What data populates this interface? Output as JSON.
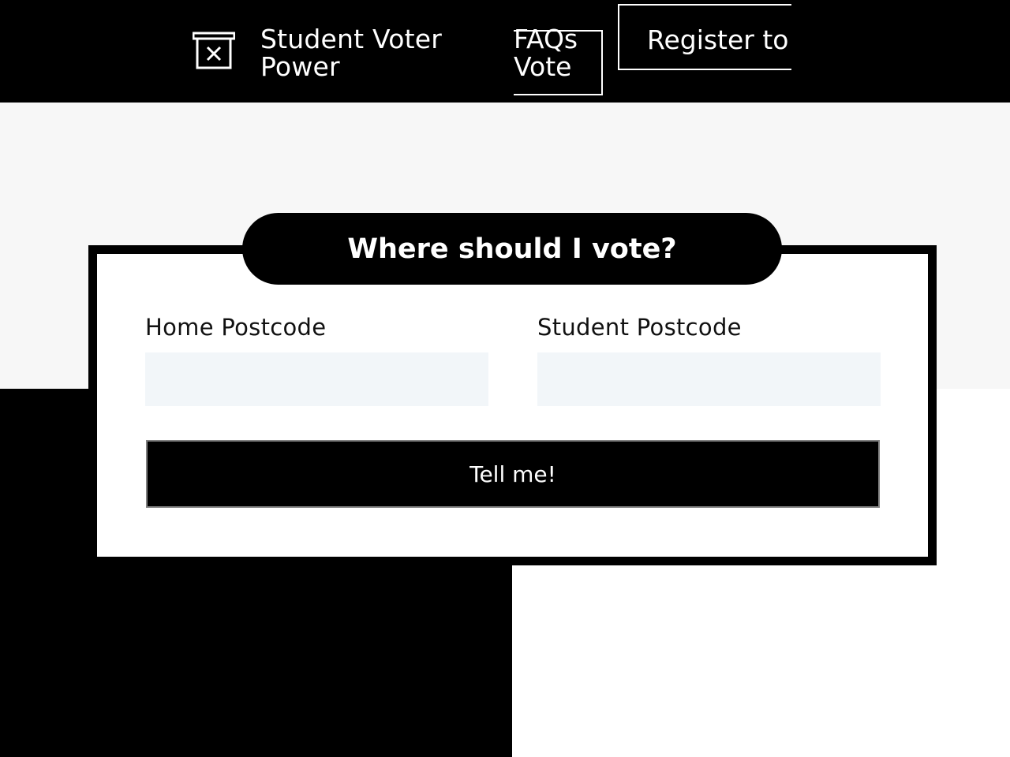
{
  "header": {
    "brand": "Student Voter Power",
    "nav": {
      "faqs": "FAQs",
      "vote": "Vote",
      "register": "Register to"
    }
  },
  "card": {
    "title": "Where should I vote?",
    "home_postcode_label": "Home Postcode",
    "home_postcode_value": "",
    "student_postcode_label": "Student Postcode",
    "student_postcode_value": "",
    "submit_label": "Tell me!"
  },
  "icons": {
    "logo": "ballot-box-icon"
  },
  "colors": {
    "primary": "#000000",
    "background": "#f7f7f7",
    "input_bg": "#f2f6f9",
    "text_on_dark": "#ffffff"
  }
}
